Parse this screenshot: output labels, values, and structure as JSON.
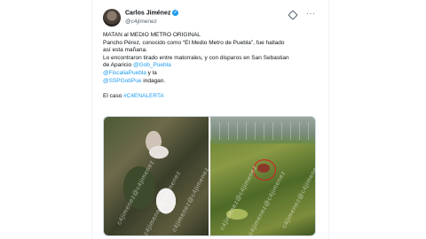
{
  "author": {
    "name": "Carlos Jiménez",
    "handle": "@c4jimenez",
    "verified_icon": "verified-badge-icon"
  },
  "header_icons": [
    "grok-icon",
    "more-options-icon"
  ],
  "more_label": "···",
  "body": {
    "line1": "MATAN al MEDIO METRO ORIGINAL",
    "line2": "Pancho Pérez, conocido como “El Medio Metro de Puebla”, fue hallado",
    "line3": "así esta mañana.",
    "line4": "Lo encontraron tirado entre matorrales, y con disparos en San Sebastian",
    "line5_prefix": "de Aparicio ",
    "mention1": "@Gob_Puebla",
    "mention2": "@FiscaliaPuebla",
    "line6_suffix": " y la",
    "mention3": "@SSPGobPue",
    "line7_suffix": " indagan.",
    "case_prefix": "El caso ",
    "hashtag": "#C4ENALERTA"
  },
  "media": {
    "watermark": "c4jimenez@c4jimenez",
    "left_photo": "crime-scene-photo-body",
    "right_photo": "crime-scene-photo-field"
  },
  "colors": {
    "link": "#1d9bf0",
    "text": "#0f1419",
    "muted": "#536471"
  }
}
